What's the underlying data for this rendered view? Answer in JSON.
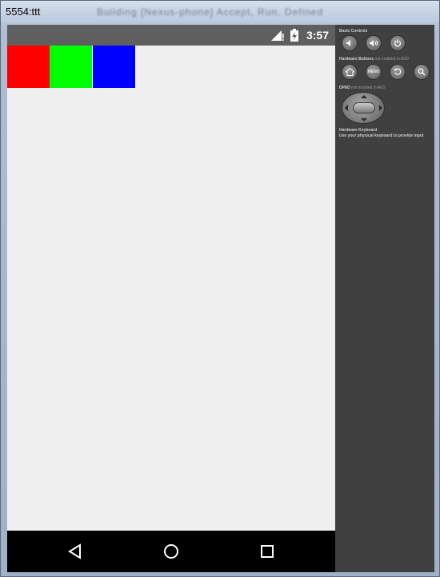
{
  "window": {
    "title": "5554:ttt",
    "blurred_title": "Building [Nexus-phone] Accept, Run, Defined"
  },
  "statusbar": {
    "time": "3:57"
  },
  "swatches": [
    {
      "color": "#ff0000"
    },
    {
      "color": "#00ff00"
    },
    {
      "color": "#0000ff"
    }
  ],
  "panel": {
    "basic_controls": "Basic Controls",
    "hardware_buttons": "Hardware Buttons",
    "hardware_buttons_note": "not enabled in AVD",
    "menu_label": "MENU",
    "dpad": "DPAD",
    "dpad_note": "not enabled in AVD",
    "hardware_keyboard": "Hardware Keyboard",
    "hardware_keyboard_note": "Use your physical keyboard to provide input"
  }
}
